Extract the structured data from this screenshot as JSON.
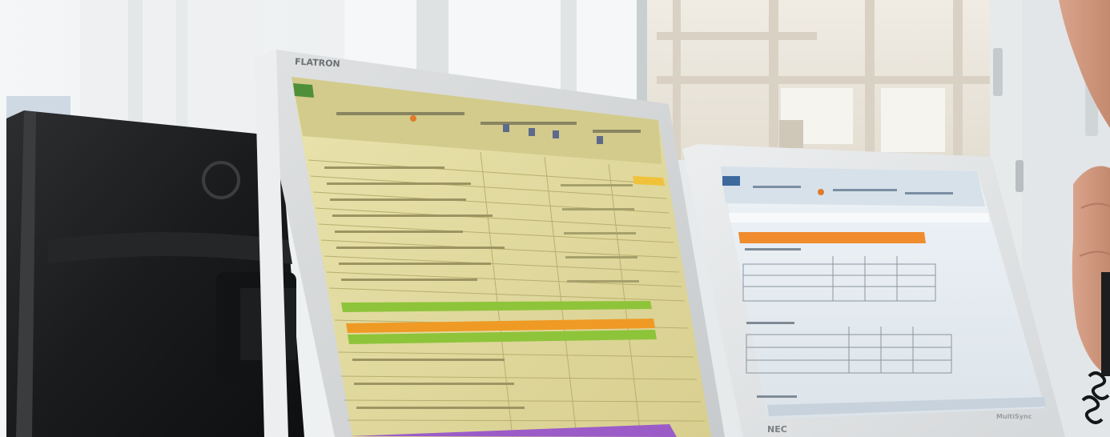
{
  "photo": {
    "subject": "",
    "monitors": {
      "left": {
        "logo": "LG",
        "logo_icon": "lg-logo-icon"
      },
      "center": {
        "bezel_brand": "FLATRON"
      },
      "right": {
        "bezel_brand": "NEC",
        "model": "MultiSync"
      }
    }
  },
  "colors": {
    "window_frame": "#d8dde0",
    "sheet_center": "#e7e0a4",
    "sheet_right": "#e6eef3",
    "green_row": "#8ec43a",
    "orange_row": "#ef9a24",
    "purple_row": "#9b5cc8",
    "right_header_orange": "#f08b2e"
  }
}
